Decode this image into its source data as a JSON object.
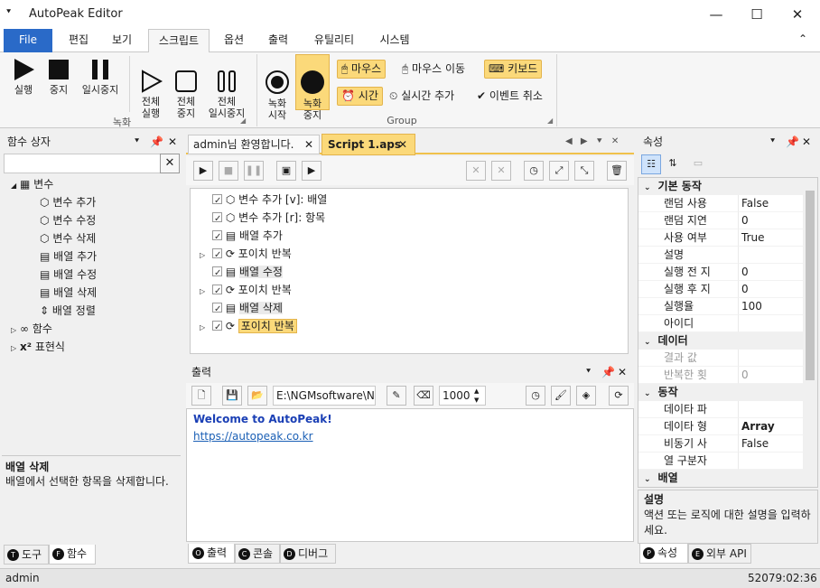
{
  "window": {
    "title": "AutoPeak Editor",
    "minimize": "—",
    "maximize": "☐",
    "close": "✕",
    "menu_icon": "⯆"
  },
  "menu": {
    "file": "File",
    "tabs": [
      "편집",
      "보기",
      "스크립트",
      "옵션",
      "출력",
      "유틸리티",
      "시스템"
    ],
    "collapse": "⌃"
  },
  "ribbon": {
    "record": {
      "run": "실행",
      "stop": "중지",
      "pause": "일시중지",
      "run_all": "전체\n실행",
      "stop_all": "전체\n중지",
      "pause_all": "전체\n일시중지",
      "group_label": "녹화"
    },
    "group": {
      "rec_start": "녹화\n시작",
      "rec_stop": "녹화\n중지",
      "mouse": "마우스",
      "mouse_move": "마우스 이동",
      "keyboard": "키보드",
      "time": "시간",
      "realtime_add": "실시간 추가",
      "event_cancel": "이벤트 취소",
      "group_label": "Group"
    }
  },
  "func_panel": {
    "title": "함수 상자",
    "search_placeholder": "",
    "clear": "✕",
    "tree": [
      {
        "label": "변수",
        "level": 0,
        "expander": "◢"
      },
      {
        "label": "변수 추가",
        "level": 1
      },
      {
        "label": "변수 수정",
        "level": 1
      },
      {
        "label": "변수 삭제",
        "level": 1
      },
      {
        "label": "배열 추가",
        "level": 1
      },
      {
        "label": "배열 수정",
        "level": 1
      },
      {
        "label": "배열 삭제",
        "level": 1
      },
      {
        "label": "배열 정렬",
        "level": 1
      },
      {
        "label": "함수",
        "level": 0,
        "expander": "▷"
      },
      {
        "label": "표현식",
        "level": 0,
        "expander": "▷"
      }
    ],
    "desc_title": "배열 삭제",
    "desc_text": "배열에서 선택한 항목을 삭제합니다.",
    "bottom_tabs": [
      {
        "icon": "T",
        "label": "도구"
      },
      {
        "icon": "F",
        "label": "함수"
      }
    ]
  },
  "editor": {
    "tabs": [
      {
        "label": "admin님 환영합니다.",
        "close": "✕"
      },
      {
        "label": "Script 1.aps",
        "close": "✕"
      }
    ],
    "nav": "◀ ▶ ⯆ ✕",
    "script": [
      {
        "label": "변수 추가 [v]: 배열",
        "expander": ""
      },
      {
        "label": "변수 추가 [r]: 항목",
        "expander": ""
      },
      {
        "label": "배열 추가",
        "expander": ""
      },
      {
        "label": "포이치 반복",
        "expander": "▷"
      },
      {
        "label": "배열 수정",
        "expander": ""
      },
      {
        "label": "포이치 반복",
        "expander": "▷"
      },
      {
        "label": "배열 삭제",
        "expander": ""
      },
      {
        "label": "포이치 반복",
        "expander": "▷"
      }
    ]
  },
  "output": {
    "title": "출력",
    "path": "E:\\NGMsoftware\\NG",
    "number": "1000",
    "welcome": "Welcome to AutoPeak!",
    "link": "https://autopeak.co.kr",
    "bottom_tabs": [
      {
        "icon": "O",
        "label": "출력"
      },
      {
        "icon": "C",
        "label": "콘솔"
      },
      {
        "icon": "D",
        "label": "디버그"
      }
    ]
  },
  "props": {
    "title": "속성",
    "rows": [
      {
        "type": "cat",
        "label": "기본 동작"
      },
      {
        "label": "랜덤 사용",
        "value": "False"
      },
      {
        "label": "랜덤 지연",
        "value": "0"
      },
      {
        "label": "사용 여부",
        "value": "True"
      },
      {
        "label": "설명",
        "value": ""
      },
      {
        "label": "실행 전 지",
        "value": "0"
      },
      {
        "label": "실행 후 지",
        "value": "0"
      },
      {
        "label": "실행율",
        "value": "100"
      },
      {
        "label": "아이디",
        "value": ""
      },
      {
        "type": "cat",
        "label": "데이터"
      },
      {
        "label": "결과 값",
        "value": "",
        "dim": true
      },
      {
        "label": "반복한 횟",
        "value": "0",
        "dim": true
      },
      {
        "type": "cat",
        "label": "동작"
      },
      {
        "label": "데이타 파",
        "value": ""
      },
      {
        "label": "데이타 형",
        "value": "Array",
        "bold": true
      },
      {
        "label": "비동기 사",
        "value": "False"
      },
      {
        "label": "열 구분자",
        "value": ""
      },
      {
        "type": "cat",
        "label": "배열"
      }
    ],
    "desc_title": "설명",
    "desc_text": "액션 또는 로직에 대한 설명을 입력하세요.",
    "bottom_tabs": [
      {
        "icon": "P",
        "label": "속성"
      },
      {
        "icon": "E",
        "label": "외부 API"
      }
    ]
  },
  "status": {
    "user": "admin",
    "time": "52079:02:36"
  }
}
